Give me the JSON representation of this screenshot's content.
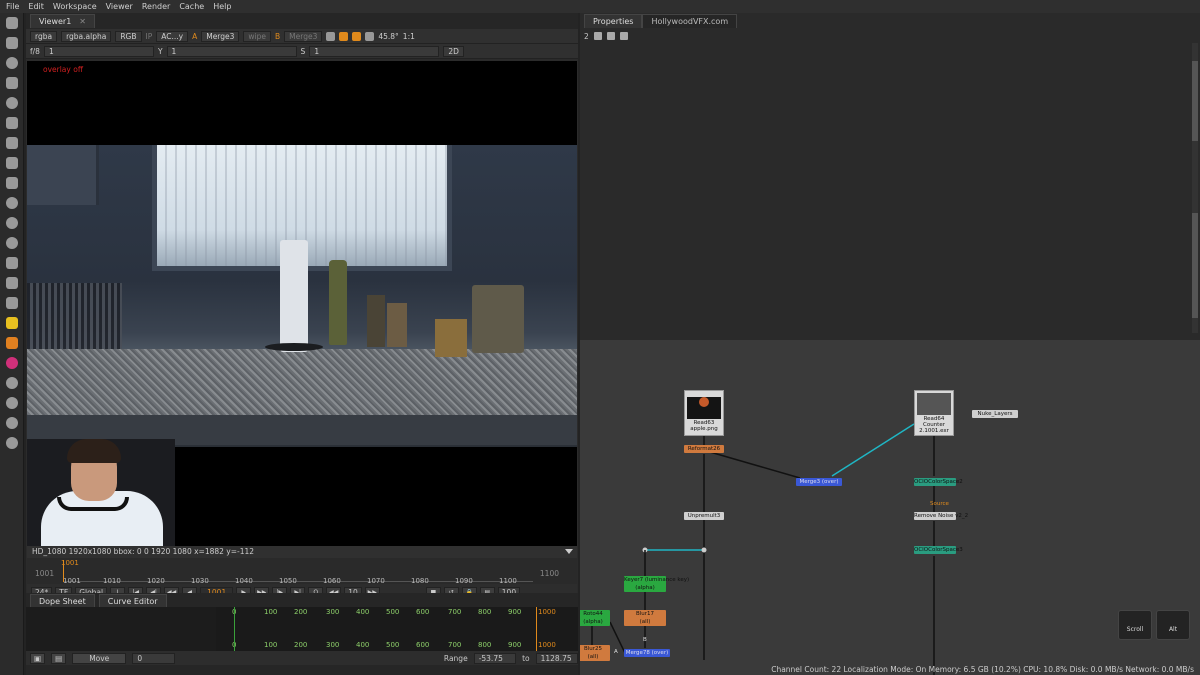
{
  "menu": [
    "File",
    "Edit",
    "Workspace",
    "Viewer",
    "Render",
    "Cache",
    "Help"
  ],
  "toolbar_icons": [
    "viewer-icon",
    "brush-icon",
    "clock-icon",
    "layers-icon",
    "circle-icon",
    "color-icon",
    "shuffle-icon",
    "3d-cube-icon",
    "move-icon",
    "particle-icon",
    "deep-icon",
    "eye-icon",
    "metadata-icon",
    "toolsets-icon",
    "gizmo-icon",
    "m-plugin-icon",
    "s-plugin-icon",
    "pin-icon",
    "flash-icon",
    "gear-icon",
    "python-icon",
    "other-icon"
  ],
  "viewer": {
    "tab": "Viewer1",
    "channels": "rgba",
    "alpha": "rgba.alpha",
    "colorspace": "RGB",
    "ip": "IP",
    "ac": "AC...y",
    "a_label": "A",
    "a_input": "Merge3",
    "wipe": "wipe",
    "b_label": "B",
    "b_input": "Merge3",
    "zoom": "45.8°",
    "ratio": "1:1",
    "fstop": "f/8",
    "fval": "1",
    "gamma_label": "Y",
    "gamma": "1",
    "sat_label": "S",
    "sat": "1",
    "view_mode": "2D",
    "overlay_text": "overlay off",
    "info": "HD_1080 1920x1080  bbox: 0 0 1920 1080  x=1882 y=-112"
  },
  "timeline": {
    "start": "1001",
    "end": "1100",
    "current": "1001",
    "ticks": [
      "1001",
      "1010",
      "1020",
      "1030",
      "1040",
      "1050",
      "1060",
      "1070",
      "1080",
      "1090",
      "1100"
    ],
    "fps": "24*",
    "tf": "TF",
    "scope": "Global",
    "increment": "10",
    "end_frame": "100"
  },
  "dope": {
    "tabs": [
      "Dope Sheet",
      "Curve Editor"
    ],
    "numbers": [
      "0",
      "100",
      "200",
      "300",
      "400",
      "500",
      "600",
      "700",
      "800",
      "900",
      "1000"
    ],
    "move_label": "Move",
    "move_value": "0",
    "range_label": "Range",
    "range_from": "-53.75",
    "to_label": "to",
    "range_to": "1128.75"
  },
  "properties": {
    "tabs": [
      "Properties",
      "HollywoodVFX.com"
    ],
    "count": "2"
  },
  "nodes": {
    "read63": [
      "Read63",
      "apple.png"
    ],
    "read64": [
      "Read64",
      "Counter 2.1001.exr"
    ],
    "reformat": "Reformat26",
    "merge": "Merge3 (over)",
    "unpremult": "Unpremult3",
    "keyer": "Keyer7 (luminance key)",
    "keyer_sub": "(alpha)",
    "blur17": "Blur17",
    "blur17_sub": "(all)",
    "roto": "Roto44",
    "roto_sub": "(alpha)",
    "blur25": "Blur25",
    "blur25_sub": "(all)",
    "merge_bottom": "Merge78 (over)",
    "ocio1": "OCIOColorSpace2",
    "source": "Source",
    "remove": "Remove Noise v2_2",
    "ocio2": "OCIOColorSpace3",
    "nuke_label": "Nuke_Layers",
    "lbl_a": "A",
    "lbl_b": "B"
  },
  "keyhints": {
    "scroll": "Scroll",
    "alt": "Alt"
  },
  "status": "Channel Count: 22  Localization Mode: On  Memory: 6.5 GB (10.2%)  CPU: 10.8%  Disk: 0.0 MB/s  Network: 0.0 MB/s",
  "colors": {
    "accent_orange": "#e08a1c",
    "merge_blue": "#3a58d6",
    "keyer_green": "#2aa840",
    "link_cyan": "#1fb6c4"
  }
}
